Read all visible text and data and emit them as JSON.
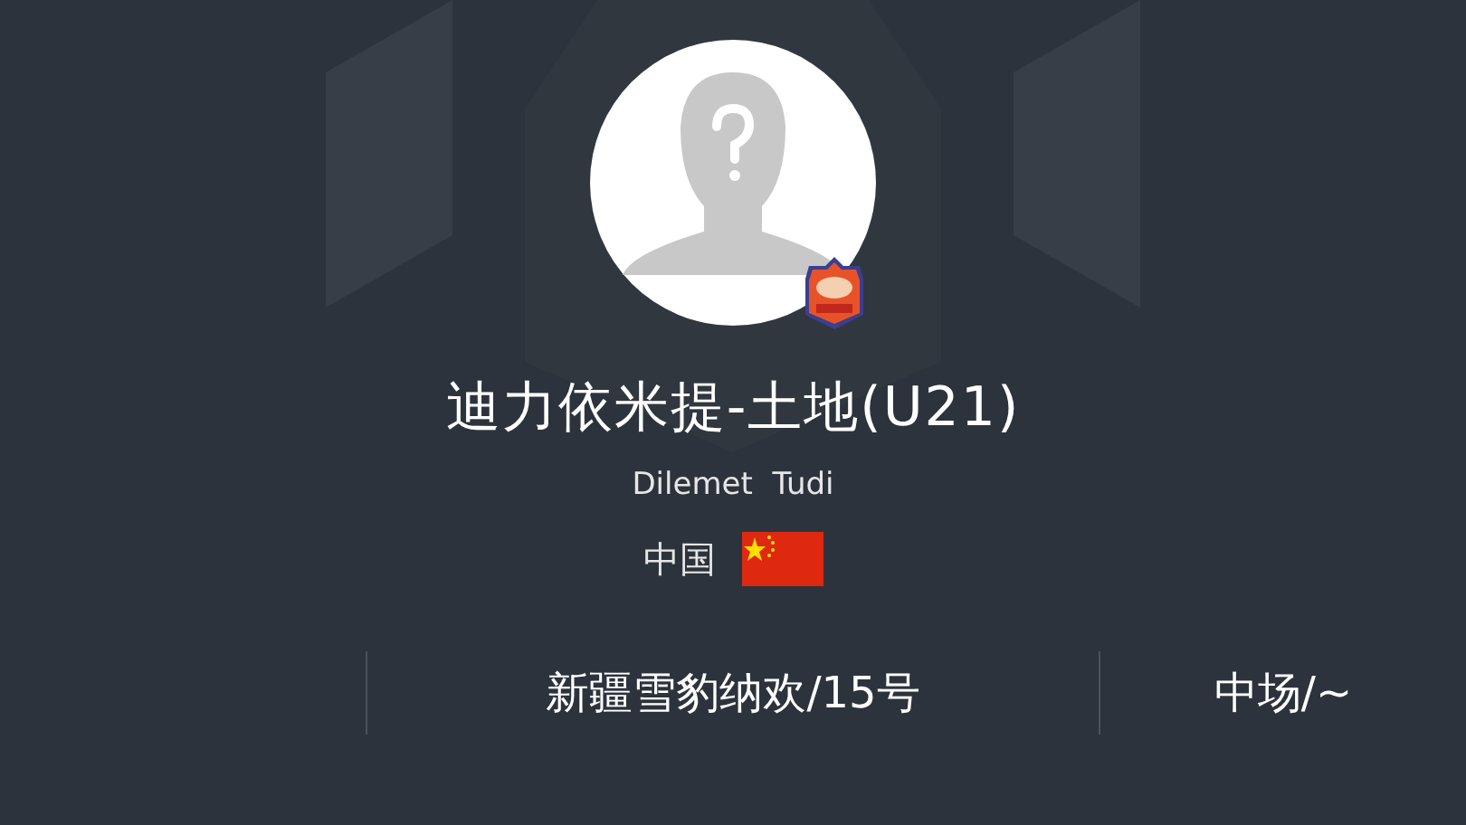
{
  "player": {
    "name": "迪力依米提-土地(U21)",
    "name_latin": "Dilemet  Tudi",
    "country": "中国"
  },
  "info": [
    {
      "text": "新疆雪豹纳欢/15号"
    },
    {
      "text": "中场/~"
    }
  ]
}
